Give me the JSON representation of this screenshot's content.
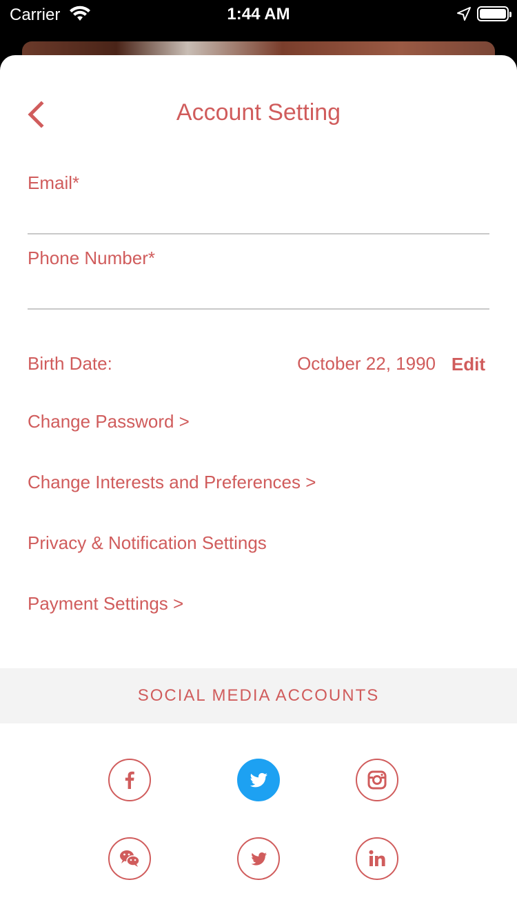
{
  "status_bar": {
    "carrier": "Carrier",
    "time": "1:44 AM",
    "wifi_icon": "wifi-icon",
    "location_icon": "location-arrow-icon",
    "battery_icon": "battery-full-icon"
  },
  "header": {
    "title": "Account Setting",
    "back_icon": "chevron-left-icon"
  },
  "form": {
    "email_label": "Email*",
    "email_value": "",
    "phone_label": "Phone Number*",
    "phone_value": ""
  },
  "birth": {
    "label": "Birth Date:",
    "value": "October 22, 1990",
    "edit_label": "Edit"
  },
  "menu": [
    {
      "label": "Change Password >"
    },
    {
      "label": "Change Interests and Preferences >"
    },
    {
      "label": "Privacy & Notification Settings"
    },
    {
      "label": "Payment Settings >"
    }
  ],
  "social": {
    "header": "SOCIAL MEDIA ACCOUNTS",
    "accounts": [
      {
        "icon": "facebook-icon",
        "connected": false
      },
      {
        "icon": "twitter-icon",
        "connected": true
      },
      {
        "icon": "instagram-icon",
        "connected": false
      },
      {
        "icon": "wechat-icon",
        "connected": false
      },
      {
        "icon": "weibo-icon",
        "connected": false
      },
      {
        "icon": "linkedin-icon",
        "connected": false
      }
    ]
  },
  "colors": {
    "accent": "#d05c5c",
    "twitter_blue": "#1da1f2",
    "section_bg": "#f3f3f3",
    "divider": "#c9c9c9"
  }
}
